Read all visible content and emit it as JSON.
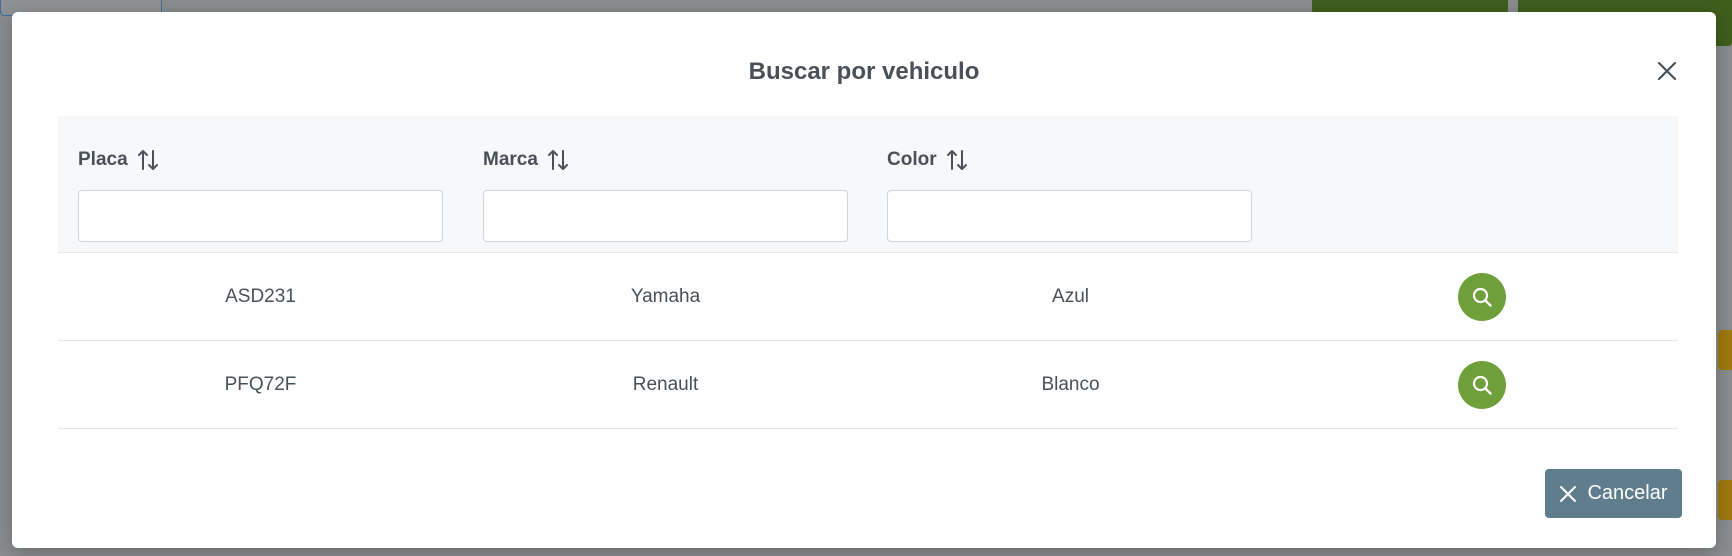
{
  "modal": {
    "title": "Buscar por vehiculo",
    "close_icon": "close-icon"
  },
  "table": {
    "columns": [
      {
        "label": "Placa",
        "sort_icon": "sort-icon",
        "filter_value": ""
      },
      {
        "label": "Marca",
        "sort_icon": "sort-icon",
        "filter_value": ""
      },
      {
        "label": "Color",
        "sort_icon": "sort-icon",
        "filter_value": ""
      }
    ],
    "rows": [
      {
        "placa": "ASD231",
        "marca": "Yamaha",
        "color": "Azul",
        "action_icon": "search-icon"
      },
      {
        "placa": "PFQ72F",
        "marca": "Renault",
        "color": "Blanco",
        "action_icon": "search-icon"
      }
    ]
  },
  "footer": {
    "cancel_label": "Cancelar",
    "cancel_icon": "close-icon"
  },
  "colors": {
    "accent_green": "#6f9f3a",
    "cancel_bg": "#5f7d8c",
    "overlay": "#8a8d8f"
  }
}
